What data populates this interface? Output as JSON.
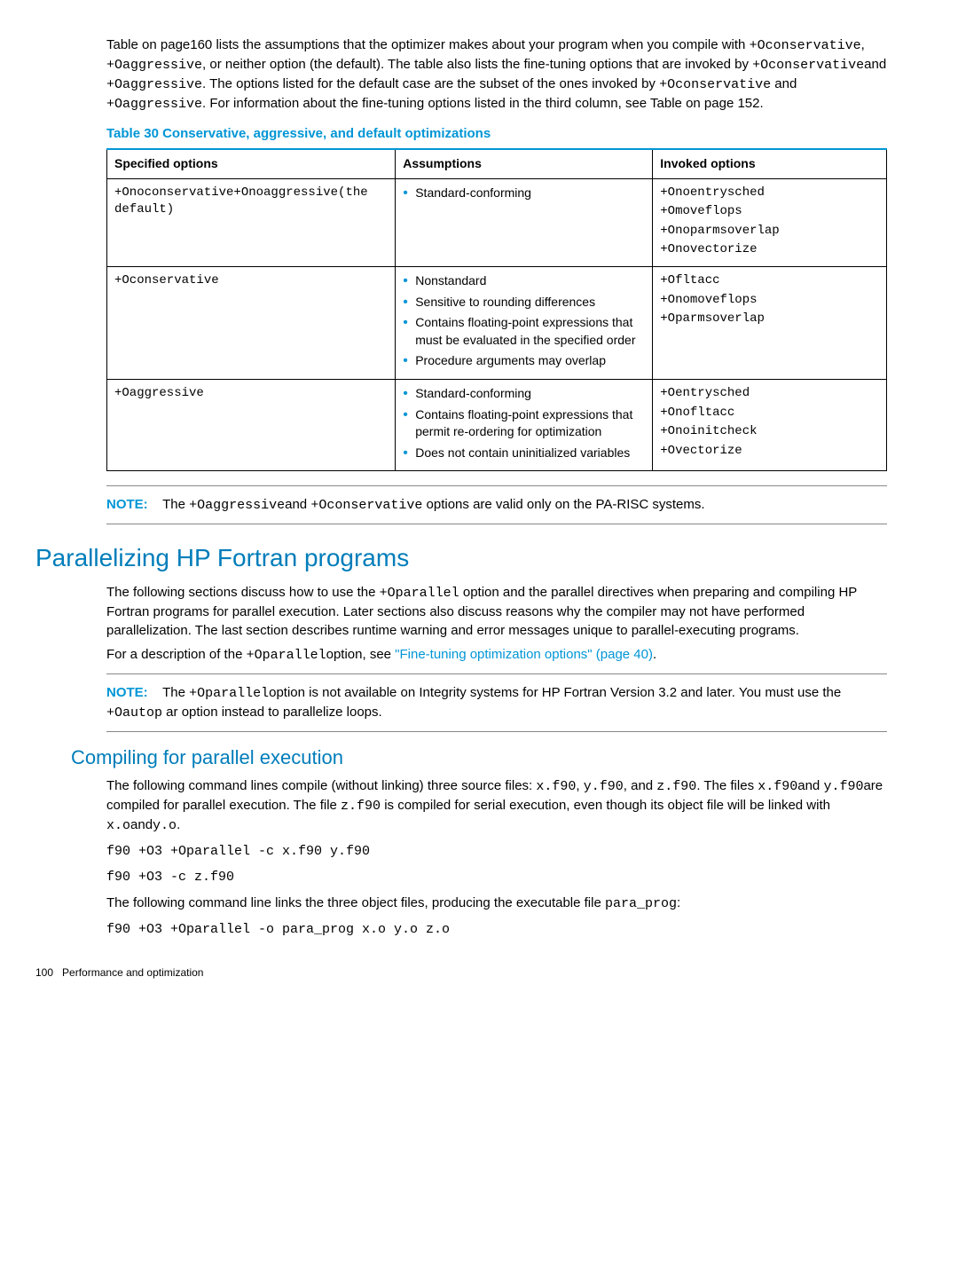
{
  "intro": {
    "p1a": "Table on page160 lists the assumptions that the optimizer makes about your program when you compile with ",
    "p1b": "+Oconservative",
    "p1c": ", ",
    "p1d": "+Oaggressive",
    "p1e": ", or neither option (the default). The table also lists the fine-tuning options that are invoked by ",
    "p1f": "+Oconservative",
    "p1g": "and ",
    "p1h": "+Oaggressive",
    "p1i": ". The options listed for the default case are the subset of the ones invoked by ",
    "p1j": "+Oconservative",
    "p1k": "  and ",
    "p1l": "+Oaggressive",
    "p1m": ". For information about the fine-tuning options listed in the third column, see Table on page 152."
  },
  "table": {
    "title": "Table 30 Conservative, aggressive, and default optimizations",
    "headers": {
      "h1": "Specified options",
      "h2": "Assumptions",
      "h3": "Invoked options"
    },
    "r1": {
      "spec": "+Onoconservative+Onoaggressive(the default)",
      "assumptions": [
        "Standard-conforming"
      ],
      "invoked": [
        "+Onoentrysched",
        "+Omoveflops",
        "+Onoparmsoverlap",
        "+Onovectorize"
      ]
    },
    "r2": {
      "spec": "+Oconservative",
      "assumptions": [
        "Nonstandard",
        "Sensitive to rounding differences",
        "Contains floating-point expressions that must be evaluated in the specified order",
        "Procedure arguments may overlap"
      ],
      "invoked": [
        "+Ofltacc",
        "+Onomoveflops",
        "+Oparmsoverlap"
      ]
    },
    "r3": {
      "spec": "+Oaggressive",
      "assumptions": [
        "Standard-conforming",
        "Contains floating-point expressions that permit re-ordering for optimization",
        "Does not contain uninitialized variables"
      ],
      "invoked": [
        "+Oentrysched",
        "+Onofltacc",
        "+Onoinitcheck",
        "+Ovectorize"
      ]
    }
  },
  "note1": {
    "label": "NOTE:",
    "a": "The ",
    "b": "+Oaggressive",
    "c": "and ",
    "d": "+Oconservative",
    "e": " options are valid only on the PA-RISC systems."
  },
  "parallel": {
    "heading": "Parallelizing HP Fortran programs",
    "p1a": "The following sections discuss how to use the ",
    "p1b": "+Oparallel",
    "p1c": " option and the parallel directives when preparing and compiling HP Fortran programs for parallel execution. Later sections also discuss reasons why the compiler may not have performed parallelization. The last section describes runtime warning and error messages unique to parallel-executing programs.",
    "p2a": "For a description of the ",
    "p2b": "+Oparallel",
    "p2c": "option, see ",
    "p2link": "\"Fine-tuning optimization options\" (page 40)",
    "p2d": "."
  },
  "note2": {
    "label": "NOTE:",
    "a": "The ",
    "b": "+Oparallel",
    "c": "option is not available on Integrity systems for HP Fortran Version 3.2 and later. You must use the ",
    "d": "+Oautop",
    "e": " ar option instead to parallelize loops."
  },
  "compiling": {
    "heading": "Compiling for parallel execution",
    "p1a": "The following command lines compile (without linking) three source files: ",
    "p1b": "x.f90",
    "p1c": ", ",
    "p1d": "y.f90",
    "p1e": ", and ",
    "p1f": "z.f90",
    "p1g": ". The files ",
    "p1h": "x.f90",
    "p1i": "and ",
    "p1j": "y.f90",
    "p1k": "are compiled for parallel execution. The file  ",
    "p1l": "z.f90",
    "p1m": " is compiled for serial execution, even though its object file will be linked with ",
    "p1n": "x.o",
    "p1o": "and",
    "p1p": "y.o",
    "p1q": ".",
    "code1": "f90 +O3 +Oparallel -c x.f90 y.f90",
    "code2": "f90 +O3 -c z.f90",
    "p2a": "The following command line links the three object files, producing the executable file ",
    "p2b": "para_prog",
    "p2c": ":",
    "code3": "f90 +O3 +Oparallel -o para_prog x.o y.o z.o"
  },
  "footer": {
    "page": "100",
    "section": "Performance and optimization"
  }
}
